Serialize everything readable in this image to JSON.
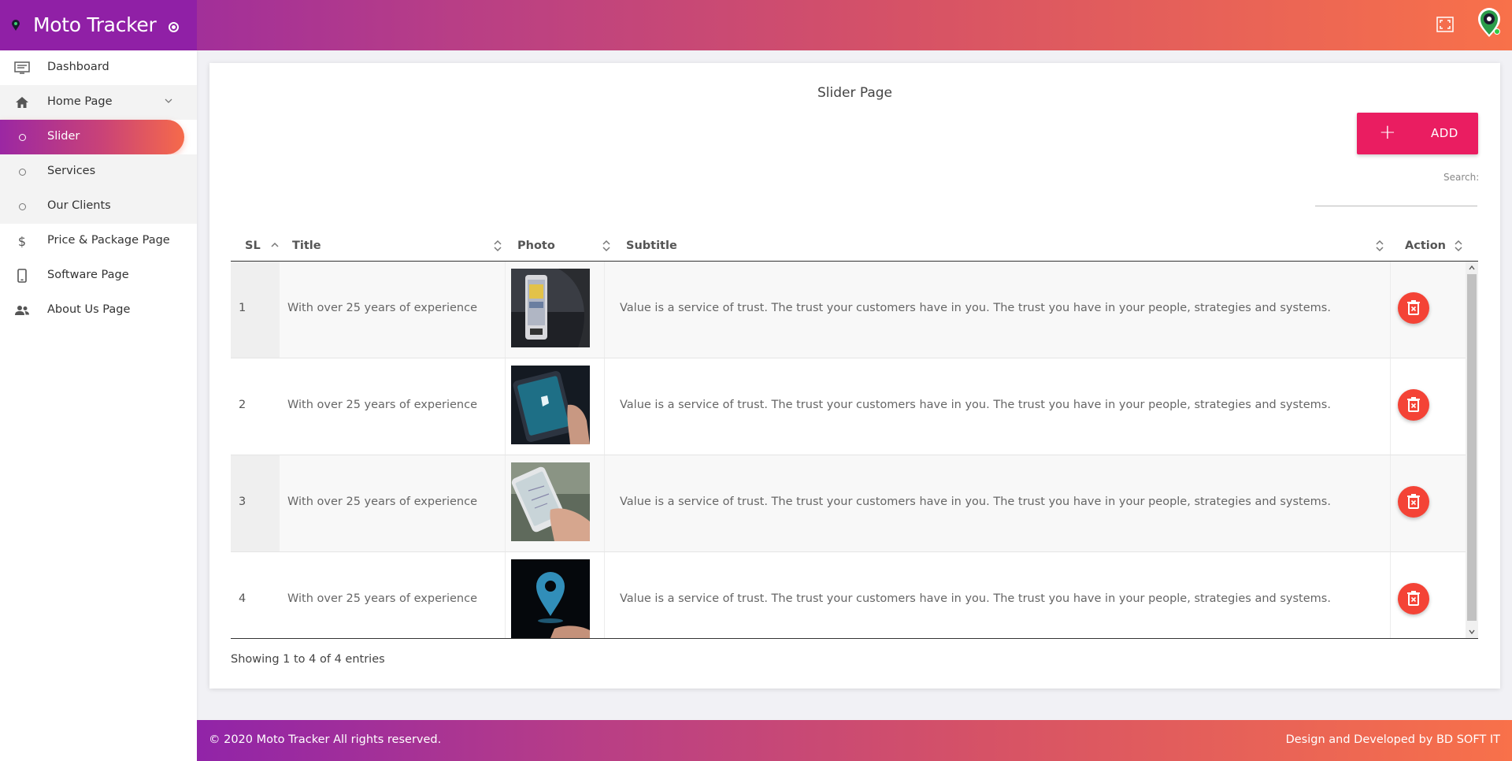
{
  "app": {
    "title": "Moto Tracker"
  },
  "sidebar": {
    "items": [
      {
        "label": "Dashboard",
        "icon": "dashboard-icon"
      },
      {
        "label": "Home Page",
        "icon": "home-icon"
      },
      {
        "label": "Slider",
        "icon": "circle-icon",
        "active": true
      },
      {
        "label": "Services",
        "icon": "circle-icon"
      },
      {
        "label": "Our Clients",
        "icon": "circle-icon"
      },
      {
        "label": "Price & Package Page",
        "icon": "dollar-icon"
      },
      {
        "label": "Software Page",
        "icon": "phone-icon"
      },
      {
        "label": "About Us Page",
        "icon": "people-icon"
      }
    ]
  },
  "page": {
    "title": "Slider Page",
    "add_plus": "+",
    "add_label": "ADD",
    "search_label": "Search:",
    "search_value": "",
    "showing": "Showing 1 to 4 of 4 entries"
  },
  "table": {
    "columns": [
      "SL",
      "Title",
      "Photo",
      "Subtitle",
      "Action"
    ],
    "rows": [
      {
        "sl": "1",
        "title": "With over 25 years of experience",
        "subtitle": "Value is a service of trust. The trust your customers have in you. The trust you have in your people, strategies and systems."
      },
      {
        "sl": "2",
        "title": "With over 25 years of experience",
        "subtitle": "Value is a service of trust. The trust your customers have in you. The trust you have in your people, strategies and systems."
      },
      {
        "sl": "3",
        "title": "With over 25 years of experience",
        "subtitle": "Value is a service of trust. The trust your customers have in you. The trust you have in your people, strategies and systems."
      },
      {
        "sl": "4",
        "title": "With over 25 years of experience",
        "subtitle": "Value is a service of trust. The trust your customers have in you. The trust you have in your people, strategies and systems."
      }
    ]
  },
  "footer": {
    "copyright": "© 2020 Moto Tracker All rights reserved.",
    "credit": "Design and Developed by BD SOFT IT"
  },
  "colors": {
    "accent": "#ea1d61",
    "delete": "#f44336",
    "brand": "#9020a6"
  }
}
